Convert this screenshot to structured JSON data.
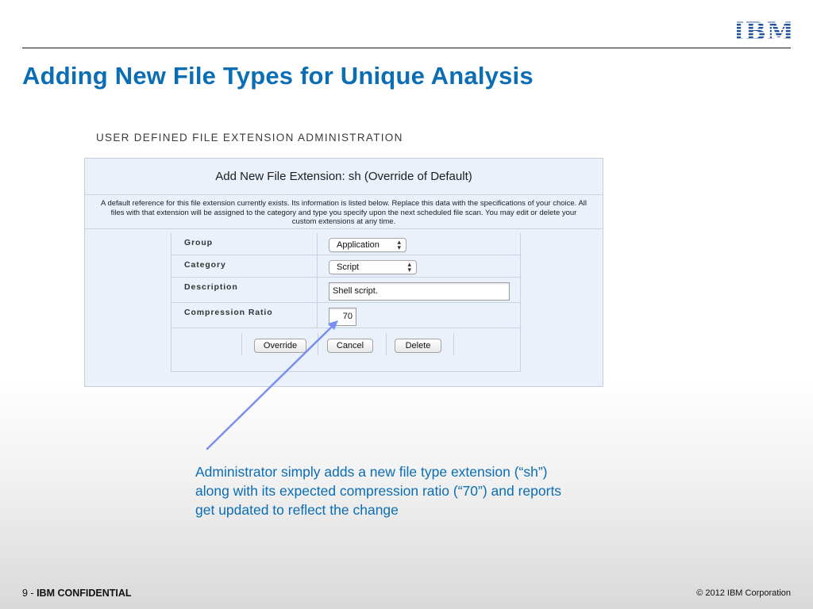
{
  "brand": {
    "logo_text": "IBM",
    "logo_color": "#1f4fa0"
  },
  "slide": {
    "title": "Adding New File Types for Unique Analysis",
    "title_color": "#0b6db3"
  },
  "admin": {
    "heading": "USER DEFINED FILE EXTENSION ADMINISTRATION",
    "panel_title": "Add New File Extension: sh (Override of Default)",
    "notice": "A default reference for this file extension currently exists. Its information is listed below. Replace this data with the specifications of your choice. All files with that extension will be assigned to the category and type you specify upon the next scheduled file scan. You may edit or delete your custom extensions at any time.",
    "form": {
      "group_label": "Group",
      "group_value": "Application",
      "category_label": "Category",
      "category_value": "Script",
      "description_label": "Description",
      "description_value": "Shell script.",
      "compression_label": "Compression Ratio",
      "compression_value": "70"
    },
    "buttons": {
      "override": "Override",
      "cancel": "Cancel",
      "delete": "Delete"
    }
  },
  "annotation": {
    "caption": "Administrator simply adds a new file type extension (“sh”) along with its expected compression ratio (“70”) and reports get updated to reflect the change",
    "arrow_color": "#7b8ff0"
  },
  "footer": {
    "page_number": "9",
    "separator": " - ",
    "confidential": "IBM CONFIDENTIAL",
    "copyright": "© 2012 IBM Corporation"
  }
}
